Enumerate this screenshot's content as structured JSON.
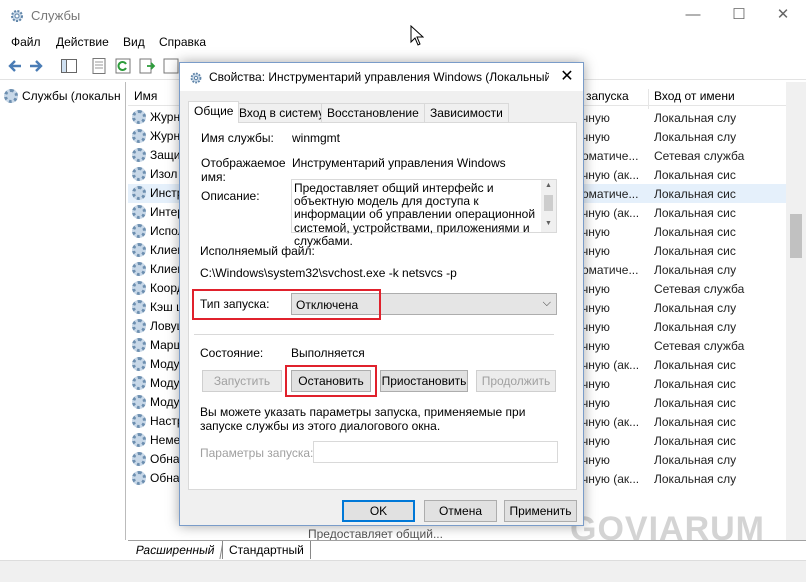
{
  "window": {
    "title": "Службы",
    "controls": {
      "minimize": "—",
      "maximize": "☐",
      "close": "✕"
    }
  },
  "menubar": [
    "Файл",
    "Действие",
    "Вид",
    "Справка"
  ],
  "toolbar_icons": [
    "back-arrow-icon",
    "forward-arrow-icon",
    "console-tree-icon",
    "properties-icon",
    "refresh-icon",
    "export-icon",
    "help-icon"
  ],
  "left_pane": {
    "tree_item": "Службы (локальн"
  },
  "list": {
    "columns": [
      "Имя",
      "запуска",
      "Вход от имени"
    ],
    "rows": [
      {
        "name": "Журн",
        "startup": "чную",
        "logon": "Локальная слу"
      },
      {
        "name": "Журн",
        "startup": "чную",
        "logon": "Локальная слу"
      },
      {
        "name": "Защи",
        "startup": "оматиче...",
        "logon": "Сетевая служба"
      },
      {
        "name": "Изол",
        "startup": "чную (ак...",
        "logon": "Локальная сис"
      },
      {
        "name": "Инстр",
        "startup": "оматиче...",
        "logon": "Локальная сис"
      },
      {
        "name": "Интер",
        "startup": "чную (ак...",
        "logon": "Локальная сис"
      },
      {
        "name": "Испол",
        "startup": "чную",
        "logon": "Локальная сис"
      },
      {
        "name": "Клиен",
        "startup": "чную",
        "logon": "Локальная сис"
      },
      {
        "name": "Клиен",
        "startup": "оматиче...",
        "logon": "Локальная слу"
      },
      {
        "name": "Коорд",
        "startup": "чную",
        "logon": "Сетевая служба"
      },
      {
        "name": "Кэш ш",
        "startup": "чную",
        "logon": "Локальная слу"
      },
      {
        "name": "Ловуш",
        "startup": "чную",
        "logon": "Локальная слу"
      },
      {
        "name": "Марш",
        "startup": "чную",
        "logon": "Сетевая служба"
      },
      {
        "name": "Моду",
        "startup": "чную (ак...",
        "logon": "Локальная сис"
      },
      {
        "name": "Моду",
        "startup": "чную",
        "logon": "Локальная сис"
      },
      {
        "name": "Моду",
        "startup": "чную",
        "logon": "Локальная сис"
      },
      {
        "name": "Настр",
        "startup": "чную (ак...",
        "logon": "Локальная сис"
      },
      {
        "name": "Неме",
        "startup": "чную",
        "logon": "Локальная сис"
      },
      {
        "name": "Обна",
        "startup": "чную",
        "logon": "Локальная слу"
      },
      {
        "name": "Обна",
        "startup": "чную (ак...",
        "logon": "Локальная слу"
      }
    ],
    "partial_row": "Предоставляет общий..."
  },
  "bottom_tabs": [
    "Расширенный",
    "Стандартный"
  ],
  "watermark": "GOVIARUM",
  "dialog": {
    "title": "Свойства: Инструментарий управления Windows (Локальный к...",
    "close": "✕",
    "tabs": [
      "Общие",
      "Вход в систему",
      "Восстановление",
      "Зависимости"
    ],
    "service_name_label": "Имя службы:",
    "service_name": "winmgmt",
    "display_name_label_1": "Отображаемое",
    "display_name_label_2": "имя:",
    "display_name": "Инструментарий управления Windows",
    "description_label": "Описание:",
    "description": "Предоставляет общий интерфейс и объектную модель для доступа к информации об управлении операционной системой, устройствами, приложениями и службами.",
    "exe_label": "Исполняемый файл:",
    "exe_path": "C:\\Windows\\system32\\svchost.exe -k netsvcs -p",
    "startup_type_label": "Тип запуска:",
    "startup_type": "Отключена",
    "status_label": "Состояние:",
    "status": "Выполняется",
    "buttons": {
      "start": "Запустить",
      "stop": "Остановить",
      "pause": "Приостановить",
      "resume": "Продолжить"
    },
    "hint": "Вы можете указать параметры запуска, применяемые при запуске службы из этого диалогового окна.",
    "params_label": "Параметры запуска:",
    "params_value": "",
    "ok": "OK",
    "cancel": "Отмена",
    "apply": "Применить"
  },
  "colors": {
    "highlight": "#e0212c",
    "accent": "#0078d7"
  }
}
